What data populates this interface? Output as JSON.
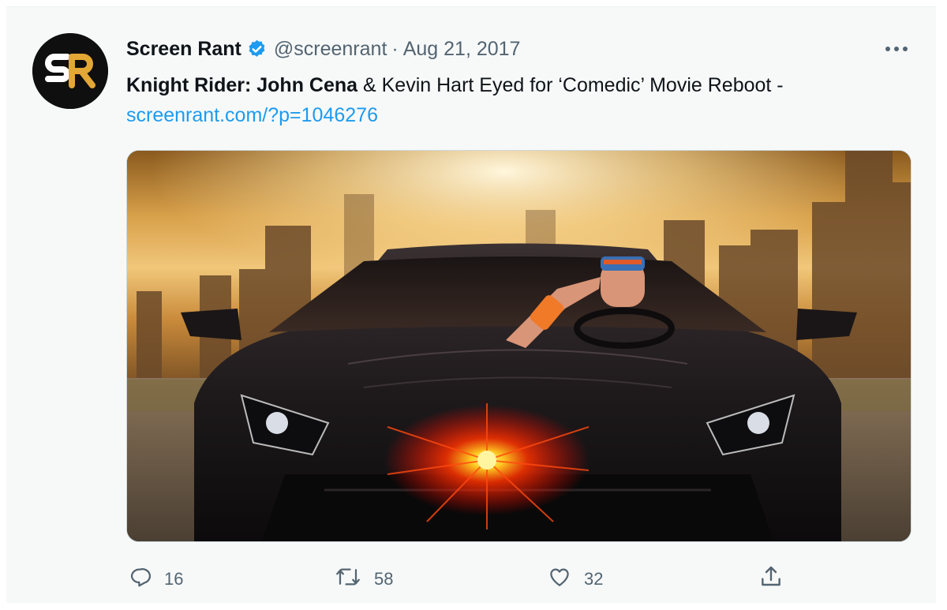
{
  "author": {
    "name": "Screen Rant",
    "handle": "@screenrant",
    "separator": "·",
    "date": "Aug 21, 2017",
    "avatar_text": "SR"
  },
  "tweet": {
    "text_bold": "Knight Rider: John Cena",
    "text_rest": " & Kevin Hart Eyed for ‘Comedic’ Movie Reboot -",
    "link": "screenrant.com/?p=1046276"
  },
  "actions": {
    "replies": "16",
    "retweets": "58",
    "likes": "32"
  },
  "icons": {
    "verified": "verified-badge-icon",
    "more": "more-options-icon",
    "reply": "reply-icon",
    "retweet": "retweet-icon",
    "like": "heart-icon",
    "share": "share-icon"
  },
  "colors": {
    "link": "#1d9bf0",
    "verified": "#1d9bf0",
    "muted": "#536471",
    "background": "#f7f9f9"
  }
}
